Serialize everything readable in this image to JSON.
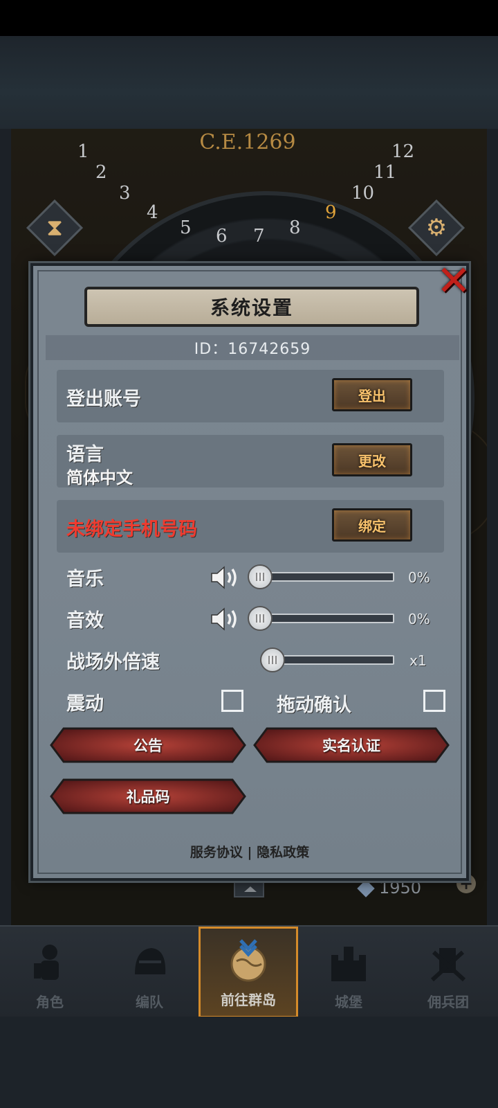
{
  "header": {
    "era": "C.E.1269"
  },
  "dial_numbers": [
    "1",
    "2",
    "3",
    "4",
    "5",
    "6",
    "7",
    "8",
    "9",
    "10",
    "11",
    "12"
  ],
  "dial_active": "9",
  "dialog": {
    "title": "系统设置",
    "id_text": "ID：16742659",
    "rows": [
      {
        "label": "登出账号",
        "button": "登出"
      },
      {
        "label": "语言",
        "sub": "简体中文",
        "button": "更改"
      },
      {
        "label": "未绑定手机号码",
        "button": "绑定"
      }
    ],
    "music": {
      "label": "音乐",
      "value": "0%",
      "level": 0
    },
    "sfx": {
      "label": "音效",
      "value": "0%",
      "level": 0
    },
    "speed": {
      "label": "战场外倍速",
      "value": "x1",
      "level": 0
    },
    "vibration": {
      "label": "震动",
      "checked": false
    },
    "drag_confirm": {
      "label": "拖动确认",
      "checked": false
    },
    "buttons": {
      "announcement": "公告",
      "realname": "实名认证",
      "giftcode": "礼品码"
    },
    "footer": {
      "terms": "服务协议",
      "separator": "|",
      "privacy": "隐私政策"
    }
  },
  "resource": {
    "value": "1950"
  },
  "nav": [
    {
      "label": "角色",
      "icon": "knight-icon"
    },
    {
      "label": "编队",
      "icon": "helmet-icon"
    },
    {
      "label": "前往群岛",
      "icon": "globe-icon",
      "active": true
    },
    {
      "label": "城堡",
      "icon": "castle-icon"
    },
    {
      "label": "佣兵团",
      "icon": "mercenary-icon"
    }
  ],
  "colors": {
    "accent_orange": "#d58b2a",
    "warn_red": "#ef3b2f",
    "close_red": "#c1201a"
  }
}
